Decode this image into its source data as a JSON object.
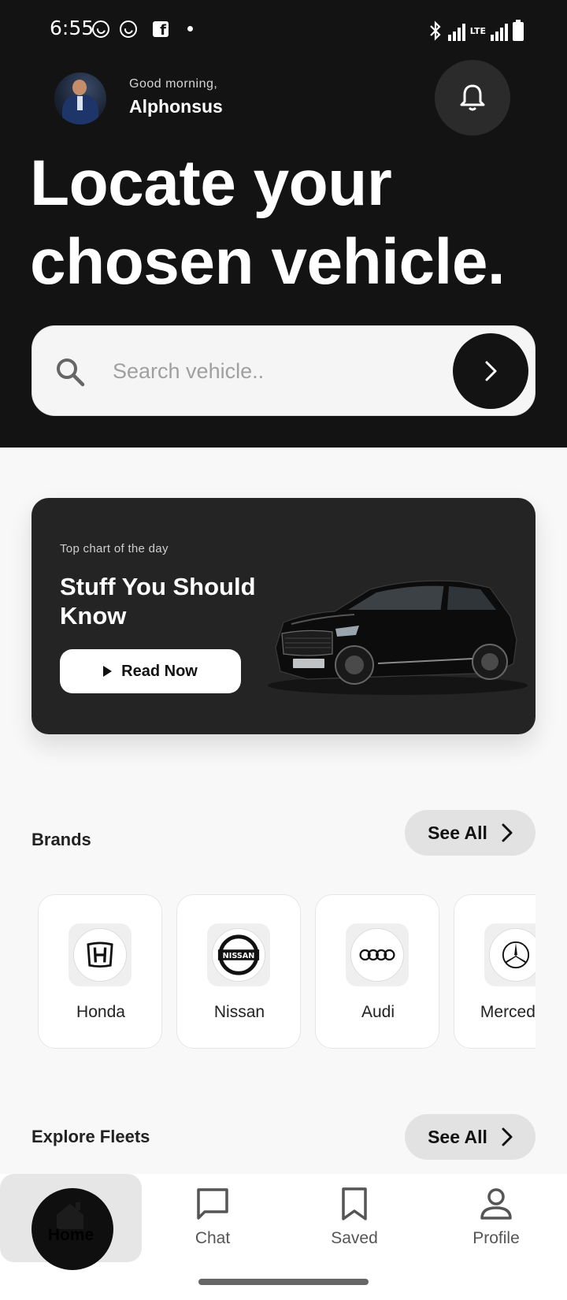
{
  "status_bar": {
    "time": "6:55",
    "icons": [
      "whatsapp-icon",
      "whatsapp-icon",
      "facebook-icon",
      "dot-icon",
      "bluetooth-icon",
      "signal-icon",
      "lte-signal-icon",
      "battery-icon"
    ],
    "network_label": "LTE"
  },
  "header": {
    "greeting": "Good morning,",
    "username": "Alphonsus",
    "notification_icon": "bell-icon"
  },
  "hero": {
    "headline": "Locate your chosen vehicle."
  },
  "search": {
    "placeholder": "Search vehicle..",
    "value": "",
    "icon": "search-icon",
    "submit_icon": "chevron-right-icon"
  },
  "promo": {
    "subtitle": "Top chart of the day",
    "title": "Stuff You Should Know",
    "button_label": "Read Now",
    "button_icon": "play-icon",
    "image": "black-suv-image"
  },
  "brands": {
    "title": "Brands",
    "see_all_label": "See All",
    "items": [
      {
        "name": "Honda",
        "logo": "honda-logo"
      },
      {
        "name": "Nissan",
        "logo": "nissan-logo"
      },
      {
        "name": "Audi",
        "logo": "audi-logo"
      },
      {
        "name": "Mercedes",
        "logo": "mercedes-logo"
      }
    ]
  },
  "fleets": {
    "title": "Explore Fleets",
    "see_all_label": "See All"
  },
  "bottom_nav": {
    "items": [
      {
        "label": "Home",
        "icon": "home-icon",
        "active": true
      },
      {
        "label": "Chat",
        "icon": "chat-icon",
        "active": false
      },
      {
        "label": "Saved",
        "icon": "bookmark-icon",
        "active": false
      },
      {
        "label": "Profile",
        "icon": "person-icon",
        "active": false
      }
    ]
  },
  "colors": {
    "header_bg": "#131313",
    "page_bg": "#f8f8f8",
    "card_bg": "#242424",
    "accent": "#111111"
  }
}
